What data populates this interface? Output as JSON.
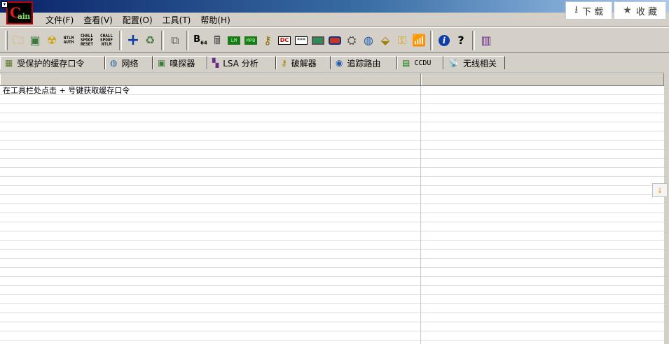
{
  "app": {
    "logo_text_c": "C",
    "logo_text_ain": "ain"
  },
  "top_actions": [
    {
      "label": "下 载",
      "icon": "download-icon"
    },
    {
      "label": "收 藏",
      "icon": "star-icon"
    }
  ],
  "menu": [
    {
      "label": "文件(F)"
    },
    {
      "label": "查看(V)"
    },
    {
      "label": "配置(O)"
    },
    {
      "label": "工具(T)"
    },
    {
      "label": "帮助(H)"
    }
  ],
  "toolbar": {
    "ntlm_auth": "NTLM\nAUTH",
    "chall_spoof_reset": "CHALL\nSPOOF\nRESET",
    "chall_spoof_ntlm": "CHALL\nSPOOF\nNTLM",
    "b64_b": "B",
    "b64_sub": "64",
    "lm_label": "LM",
    "mpb_label": "MPB",
    "dc_label": "DC",
    "stars_label": "***"
  },
  "tabs": [
    {
      "label": "受保护的缓存口令",
      "icon": "cache-icon"
    },
    {
      "label": "网络",
      "icon": "network-icon"
    },
    {
      "label": "嗅探器",
      "icon": "sniffer-icon"
    },
    {
      "label": "LSA 分析",
      "icon": "lsa-icon"
    },
    {
      "label": "破解器",
      "icon": "cracker-icon"
    },
    {
      "label": "追踪路由",
      "icon": "traceroute-icon"
    },
    {
      "label": "CCDU",
      "icon": "ccdu-icon"
    },
    {
      "label": "无线相关",
      "icon": "wireless-icon"
    }
  ],
  "grid": {
    "hint": "在工具栏处点击 + 号键获取缓存口令"
  },
  "colors": {
    "title_start": "#0a246a",
    "chrome": "#d4d0c8",
    "accent_blue": "#0f3ea8"
  }
}
